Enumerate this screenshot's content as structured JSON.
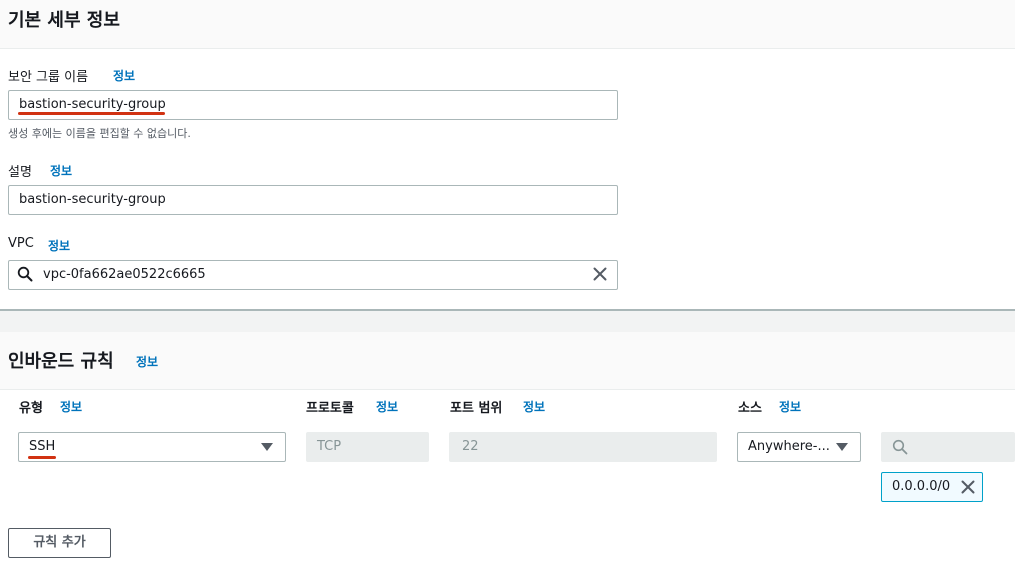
{
  "basic": {
    "title": "기본 세부 정보",
    "sg_name_label": "보안 그룹 이름",
    "sg_name_value": "bastion-security-group",
    "sg_name_hint": "생성 후에는 이름을 편집할 수 없습니다.",
    "desc_label": "설명",
    "desc_value": "bastion-security-group",
    "vpc_label": "VPC",
    "vpc_value": "vpc-0fa662ae0522c6665"
  },
  "info_link": "정보",
  "inbound": {
    "title": "인바운드 규칙",
    "col_type": "유형",
    "col_protocol": "프로토콜",
    "col_port": "포트 범위",
    "col_source": "소스",
    "row": {
      "type_value": "SSH",
      "protocol_value": "TCP",
      "port_value": "22",
      "source_value": "Anywhere-...",
      "cidr_token": "0.0.0.0/0"
    },
    "add_rule_label": "규칙 추가"
  },
  "icons": {
    "search": "search-icon",
    "clear": "close-icon",
    "dropdown": "caret-down-icon",
    "remove": "close-icon"
  },
  "colors": {
    "link": "#0073bb",
    "underline": "#d13212",
    "header_bg": "#fafafa",
    "token_border": "#00a1c9"
  }
}
